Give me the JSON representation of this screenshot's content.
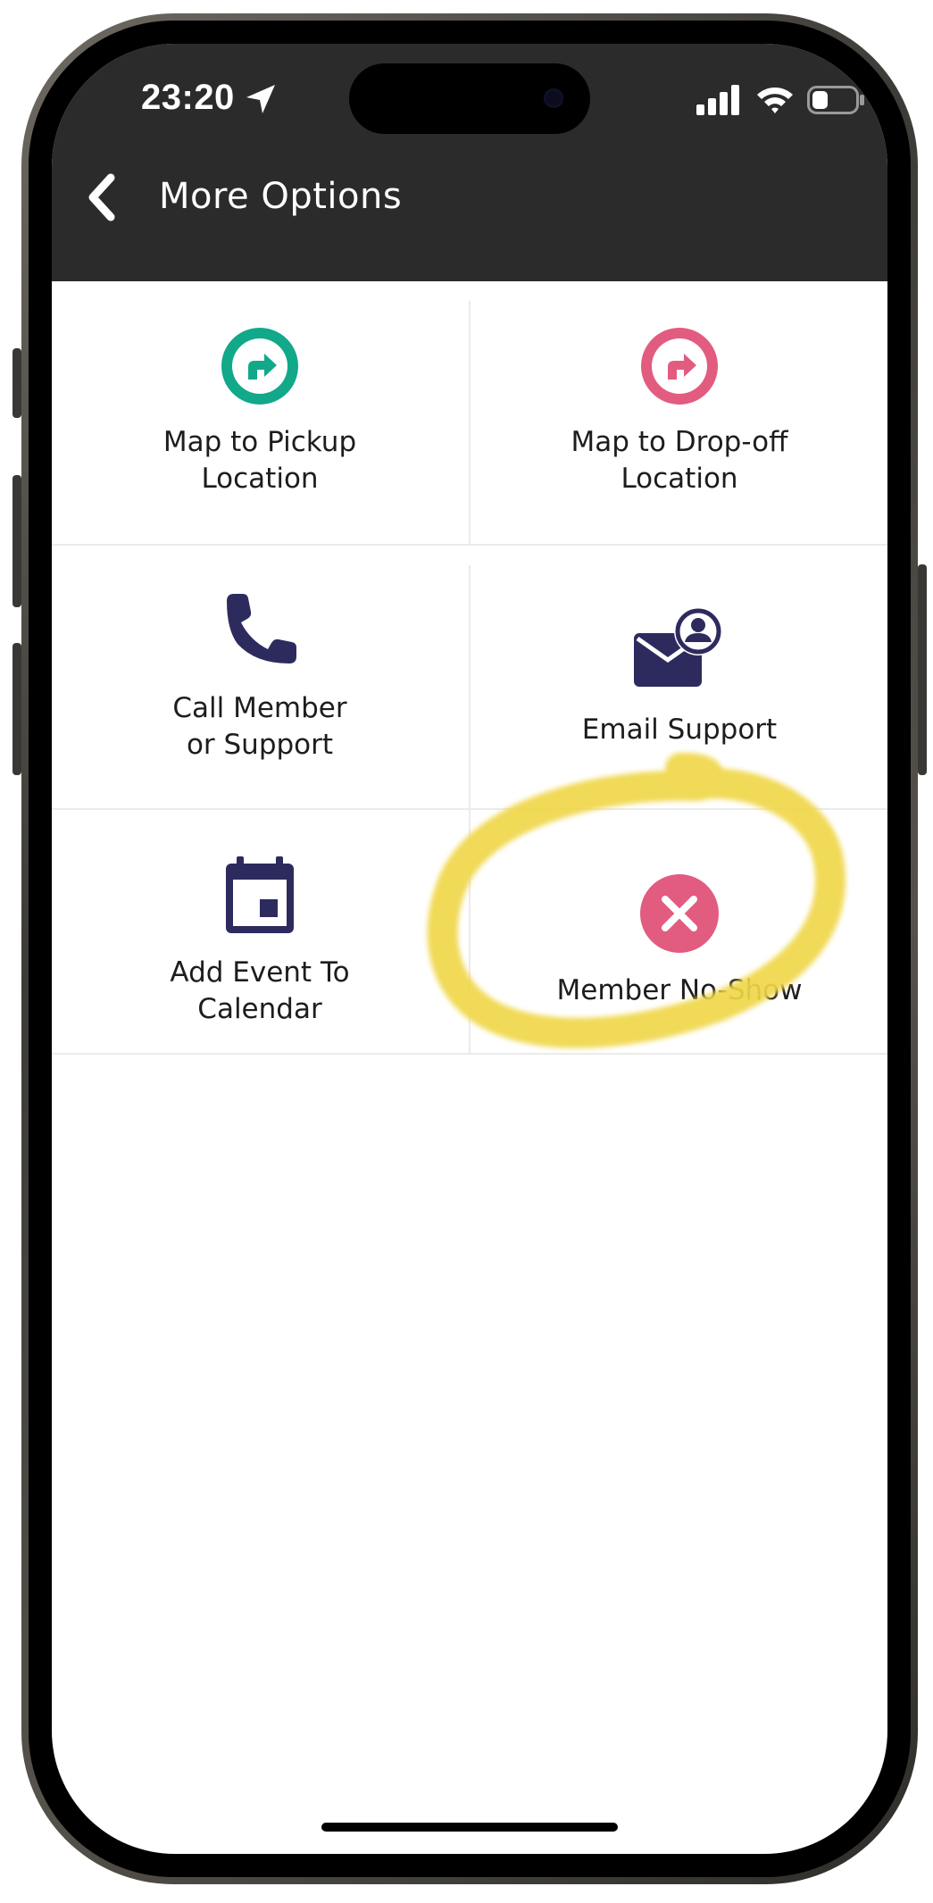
{
  "status_bar": {
    "time": "23:20",
    "icons": [
      "location-arrow-icon",
      "cellular-signal-icon",
      "wifi-icon",
      "battery-icon"
    ]
  },
  "nav": {
    "back_icon": "chevron-left-icon",
    "title": "More Options"
  },
  "options": [
    {
      "label": "Map to Pickup\nLocation",
      "icon": "turn-right-arrow-icon",
      "color": "#12a88a"
    },
    {
      "label": "Map to Drop-off\nLocation",
      "icon": "turn-right-arrow-icon",
      "color": "#e25c80"
    },
    {
      "label": "Call Member\nor Support",
      "icon": "phone-icon",
      "color": "#2d2b5e"
    },
    {
      "label": "Email Support",
      "icon": "mail-person-icon",
      "color": "#2d2b5e"
    },
    {
      "label": "Add Event To\nCalendar",
      "icon": "calendar-icon",
      "color": "#2d2b5e"
    },
    {
      "label": "Member No-Show",
      "icon": "close-circle-icon",
      "color": "#e25c80"
    }
  ],
  "colors": {
    "header_bg": "#2b2b2b",
    "highlight": "#f0d74a"
  }
}
